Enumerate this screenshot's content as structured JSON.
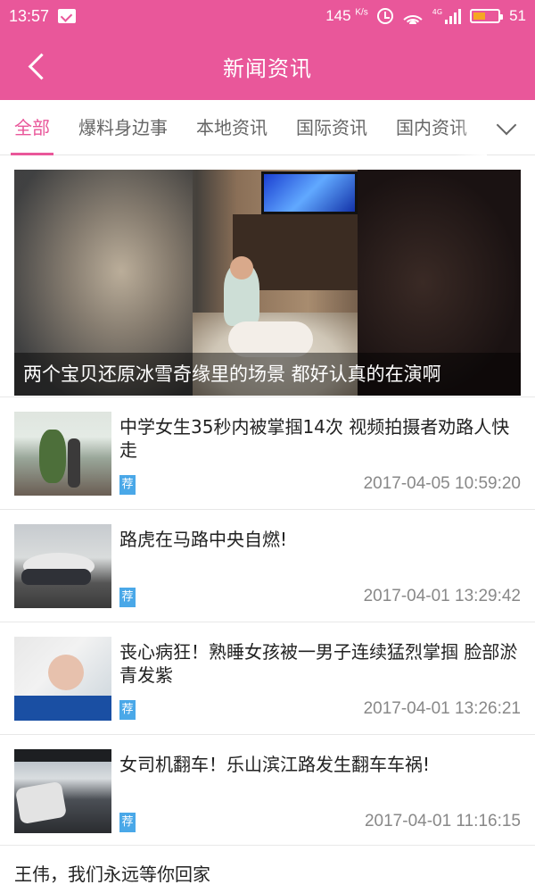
{
  "status_bar": {
    "time": "13:57",
    "speed": "145",
    "speed_unit": "K/s",
    "network": "4G",
    "battery": "51",
    "battery_level": 0.51,
    "battery_color": "#f5a623"
  },
  "header": {
    "title": "新闻资讯",
    "background": "#e9579a"
  },
  "tabs": [
    {
      "label": "全部",
      "active": true
    },
    {
      "label": "爆料身边事",
      "active": false
    },
    {
      "label": "本地资讯",
      "active": false
    },
    {
      "label": "国际资讯",
      "active": false
    },
    {
      "label": "国内资讯",
      "active": false
    }
  ],
  "hero": {
    "caption": "两个宝贝还原冰雪奇缘里的场景 都好认真的在演啊"
  },
  "news": [
    {
      "title": "中学女生35秒内被掌掴14次 视频拍摄者劝路人快走",
      "tag": "荐",
      "date": "2017-04-05 10:59:20"
    },
    {
      "title": "路虎在马路中央自燃!",
      "tag": "荐",
      "date": "2017-04-01 13:29:42"
    },
    {
      "title": "丧心病狂！熟睡女孩被一男子连续猛烈掌掴 脸部淤青发紫",
      "tag": "荐",
      "date": "2017-04-01 13:26:21"
    },
    {
      "title": "女司机翻车！乐山滨江路发生翻车车祸!",
      "tag": "荐",
      "date": "2017-04-01 11:16:15"
    }
  ],
  "last_item": {
    "title": "王伟，我们永远等你回家"
  },
  "colors": {
    "accent": "#e9579a",
    "tag": "#4aa8e8"
  }
}
